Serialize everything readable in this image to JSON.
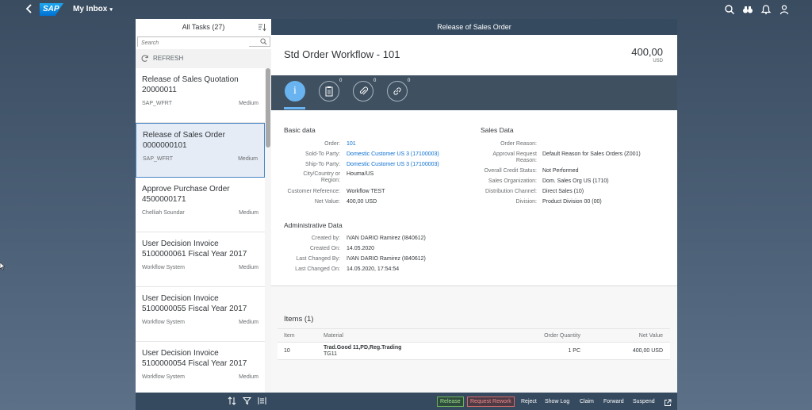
{
  "shell": {
    "back_icon": "chevron-left-icon",
    "logo_text": "SAP",
    "title": "My Inbox",
    "title_caret": "▾",
    "icons": [
      "search-icon",
      "binoculars-icon",
      "bell-icon",
      "user-icon"
    ]
  },
  "master": {
    "header": "All Tasks (27)",
    "search_placeholder": "Search",
    "refresh_label": "REFRESH",
    "items": [
      {
        "title": "Release of Sales Quotation 20000011",
        "sub": "SAP_WFRT",
        "priority": "Medium"
      },
      {
        "title": "Release of Sales Order 0000000101",
        "sub": "SAP_WFRT",
        "priority": "Medium"
      },
      {
        "title": "Approve Purchase Order 4500000171",
        "sub": "Chelliah Soundar",
        "priority": "Medium"
      },
      {
        "title": "User Decision Invoice 5100000061 Fiscal Year 2017",
        "sub": "Workflow System",
        "priority": "Medium"
      },
      {
        "title": "User Decision Invoice 5100000055 Fiscal Year 2017",
        "sub": "Workflow System",
        "priority": "Medium"
      },
      {
        "title": "User Decision Invoice 5100000054 Fiscal Year 2017",
        "sub": "Workflow System",
        "priority": "Medium"
      }
    ],
    "selected_index": 1
  },
  "detail": {
    "bar_title": "Release of Sales Order",
    "object_title": "Std Order Workflow - 101",
    "number": "400,00",
    "unit": "USD",
    "tabs": [
      {
        "icon": "info-icon",
        "label": "i",
        "count": ""
      },
      {
        "icon": "notes-icon",
        "count": "0"
      },
      {
        "icon": "attachment-icon",
        "count": "0"
      },
      {
        "icon": "link-icon",
        "count": "0"
      }
    ],
    "basic_data": {
      "title": "Basic data",
      "fields": [
        {
          "label": "Order:",
          "value": "101"
        },
        {
          "label": "Sold-To Party:",
          "value": "Domestic Customer US 3 (17100003)"
        },
        {
          "label": "Ship-To Party:",
          "value": "Domestic Customer US 3 (17100003)"
        },
        {
          "label": "City/Country or Region:",
          "label_1": "City/Country or",
          "label_2": "Region:",
          "value": "Houma/US"
        },
        {
          "label": "Customer Reference:",
          "value": "Workflow TEST"
        },
        {
          "label": "Net Value:",
          "value": "400,00  USD"
        }
      ]
    },
    "sales_data": {
      "title": "Sales Data",
      "fields": [
        {
          "label": "Order Reason:",
          "value": ""
        },
        {
          "label_1": "Approval Request",
          "label_2": "Reason:",
          "value": "Default Reason for Sales Orders (Z001)"
        },
        {
          "label": "Overall Credit Status:",
          "value": "Not Performed"
        },
        {
          "label": "Sales Organization:",
          "value": "Dom. Sales Org US (1710)"
        },
        {
          "label": "Distribution Channel:",
          "value": "Direct Sales (10)"
        },
        {
          "label": "Division:",
          "value": "Product Division 00 (00)"
        }
      ]
    },
    "admin_data": {
      "title": "Administrative Data",
      "fields": [
        {
          "label": "Created by:",
          "value": "IVAN DARIO Ramirez (I840612)"
        },
        {
          "label": "Created On:",
          "value": "14.05.2020"
        },
        {
          "label": "Last Changed By:",
          "value": "IVAN DARIO Ramirez (I840612)"
        },
        {
          "label": "Last Changed On:",
          "value": "14.05.2020, 17:54:54"
        }
      ]
    },
    "items": {
      "title": "Items (1)",
      "columns": [
        "Item",
        "Material",
        "Order Quantity",
        "Net Value"
      ],
      "rows": [
        {
          "item": "10",
          "material": "Trad.Good 11,PD,Reg.Trading",
          "material_id": "TG11",
          "quantity": "1 PC",
          "net_value": "400,00  USD"
        }
      ]
    },
    "footer": {
      "release": "Release",
      "request_rework": "Request Rework",
      "reject": "Reject",
      "show_log": "Show Log",
      "claim": "Claim",
      "forward": "Forward",
      "suspend": "Suspend"
    }
  }
}
